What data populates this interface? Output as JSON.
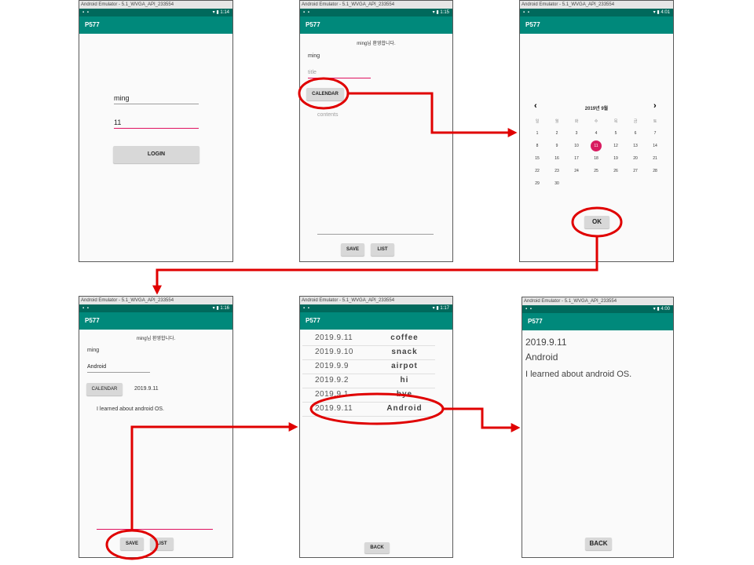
{
  "app_title": "P577",
  "window_title": "Android Emulator - 5.1_WVGA_API_233554",
  "colors": {
    "appbar": "#00897b",
    "statusbar": "#00695c",
    "annotation": "#e00000",
    "accent": "#d81b60"
  },
  "screens": {
    "login": {
      "time": "1:14",
      "id_value": "ming",
      "pw_value": "11",
      "login_button": "LOGIN"
    },
    "write": {
      "time": "1:15",
      "welcome": "ming님 환영합니다.",
      "user": "ming",
      "title_hint": "title",
      "calendar_button": "CALENDAR",
      "contents_hint": "contents",
      "save_button": "SAVE",
      "list_button": "LIST"
    },
    "calendar": {
      "time": "4:01",
      "month_label": "2019년 9월",
      "prev": "‹",
      "next": "›",
      "weekdays": [
        "일",
        "월",
        "화",
        "수",
        "목",
        "금",
        "토"
      ],
      "weeks": [
        [
          "1",
          "2",
          "3",
          "4",
          "5",
          "6",
          "7"
        ],
        [
          "8",
          "9",
          "10",
          "11",
          "12",
          "13",
          "14"
        ],
        [
          "15",
          "16",
          "17",
          "18",
          "19",
          "20",
          "21"
        ],
        [
          "22",
          "23",
          "24",
          "25",
          "26",
          "27",
          "28"
        ],
        [
          "29",
          "30",
          "",
          "",
          "",
          "",
          ""
        ]
      ],
      "selected_day": "11",
      "ok_button": "OK"
    },
    "filled": {
      "time": "1:16",
      "welcome": "ming님 환영합니다.",
      "user": "ming",
      "title_value": "Android",
      "calendar_button": "CALENDAR",
      "date_value": "2019.9.11",
      "contents_value": "I learned about android OS.",
      "save_button": "SAVE",
      "list_button": "LIST"
    },
    "list": {
      "time": "1:17",
      "rows": [
        {
          "date": "2019.9.11",
          "title": "coffee"
        },
        {
          "date": "2019.9.10",
          "title": "snack"
        },
        {
          "date": "2019.9.9",
          "title": "airpot"
        },
        {
          "date": "2019.9.2",
          "title": "hi"
        },
        {
          "date": "2019.9.1",
          "title": "bye"
        },
        {
          "date": "2019.9.11",
          "title": "Android"
        }
      ],
      "back_button": "BACK"
    },
    "detail": {
      "time": "4:00",
      "date": "2019.9.11",
      "title": "Android",
      "contents": "I learned about android OS.",
      "back_button": "BACK"
    }
  }
}
